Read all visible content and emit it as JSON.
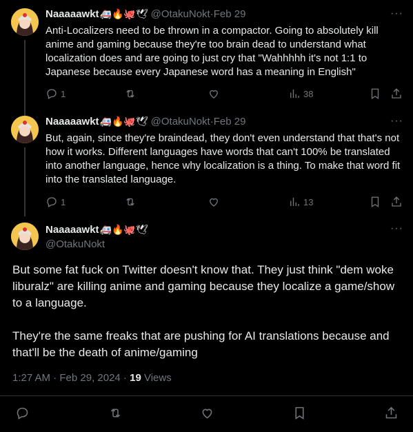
{
  "tweets": [
    {
      "name": "Naaaaawkt",
      "emojis": "🚑🔥🐙🕊",
      "handle": "@OtakuNokt",
      "date": "Feb 29",
      "text": "Anti-Localizers need to be thrown in a compactor. Going to absolutely kill anime and gaming because they're too brain dead to understand what localization does and are going to just cry that \"Wahhhhh it's not 1:1 to Japanese because every Japanese word has a meaning in English\"",
      "replies": "1",
      "views": "38"
    },
    {
      "name": "Naaaaawkt",
      "emojis": "🚑🔥🐙🕊",
      "handle": "@OtakuNokt",
      "date": "Feb 29",
      "text": "But, again, since they're braindead, they don't even understand that that's not how it works. Different languages have words that can't 100% be translated into another language, hence why localization is a thing. To make that word fit into the translated language.",
      "replies": "1",
      "views": "13"
    }
  ],
  "main": {
    "name": "Naaaaawkt",
    "emojis": "🚑🔥🐙🕊",
    "handle": "@OtakuNokt",
    "para1": "But some fat fuck on Twitter doesn't know that. They just think \"dem woke liburalz\" are killing anime and gaming because they localize a game/show to a language.",
    "para2": "They're the same freaks that are pushing for AI translations because and that'll be the death of anime/gaming",
    "timestamp": "1:27 AM · Feb 29, 2024 · ",
    "views_count": "19",
    "views_label": " Views"
  },
  "separators": {
    "dot": " · ",
    "more": "···"
  },
  "icons": [
    "reply-icon",
    "retweet-icon",
    "like-icon",
    "views-icon",
    "bookmark-icon",
    "share-icon",
    "more-icon"
  ]
}
